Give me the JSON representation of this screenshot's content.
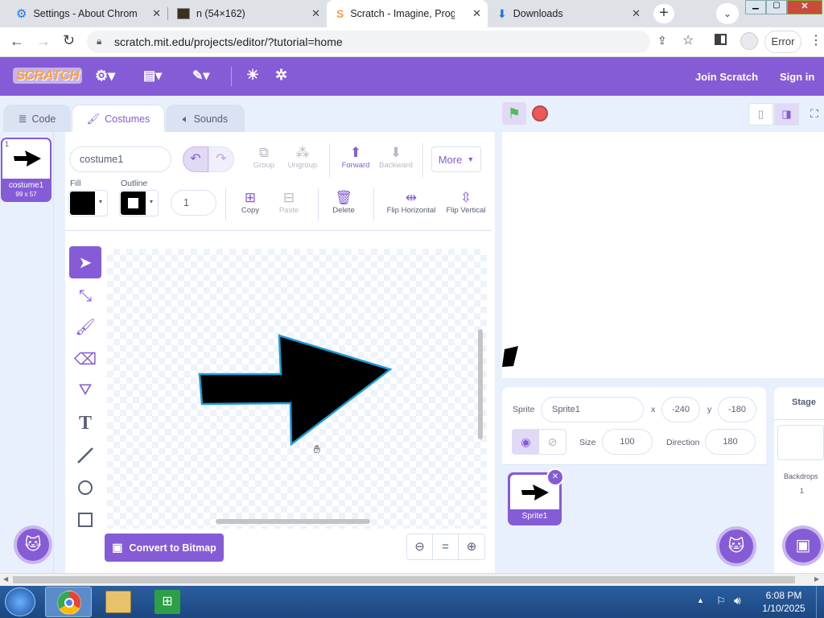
{
  "browser": {
    "tabs": [
      {
        "title": "Settings - About Chrome"
      },
      {
        "title": "n (54×162)"
      },
      {
        "title": "Scratch - Imagine, Program"
      },
      {
        "title": "Downloads"
      }
    ],
    "url": "scratch.mit.edu/projects/editor/?tutorial=home",
    "error_label": "Error"
  },
  "menubar": {
    "logo": "SCRATCH",
    "join": "Join Scratch",
    "signin": "Sign in"
  },
  "editor_tabs": {
    "code": "Code",
    "costumes": "Costumes",
    "sounds": "Sounds"
  },
  "costume_list": [
    {
      "index": "1",
      "name": "costume1",
      "size": "99 x 57"
    }
  ],
  "paint": {
    "costume_name": "costume1",
    "group": "Group",
    "ungroup": "Ungroup",
    "forward": "Forward",
    "backward": "Backward",
    "more": "More",
    "fill_label": "Fill",
    "outline_label": "Outline",
    "outline_width": "1",
    "copy": "Copy",
    "paste": "Paste",
    "delete": "Delete",
    "flip_h": "Flip Horizontal",
    "flip_v": "Flip Vertical",
    "convert": "Convert to Bitmap",
    "fill_color": "#000000",
    "outline_color": "#000000",
    "accent": "#855cd6"
  },
  "sprite_info": {
    "sprite_label": "Sprite",
    "sprite_name": "Sprite1",
    "x_label": "x",
    "x": "-240",
    "y_label": "y",
    "y": "-180",
    "size_label": "Size",
    "size": "100",
    "direction_label": "Direction",
    "direction": "180"
  },
  "sprites": [
    {
      "name": "Sprite1"
    }
  ],
  "stage_panel": {
    "title": "Stage",
    "backdrops_label": "Backdrops",
    "backdrops_count": "1"
  },
  "taskbar": {
    "time": "6:08 PM",
    "date": "1/10/2025"
  }
}
